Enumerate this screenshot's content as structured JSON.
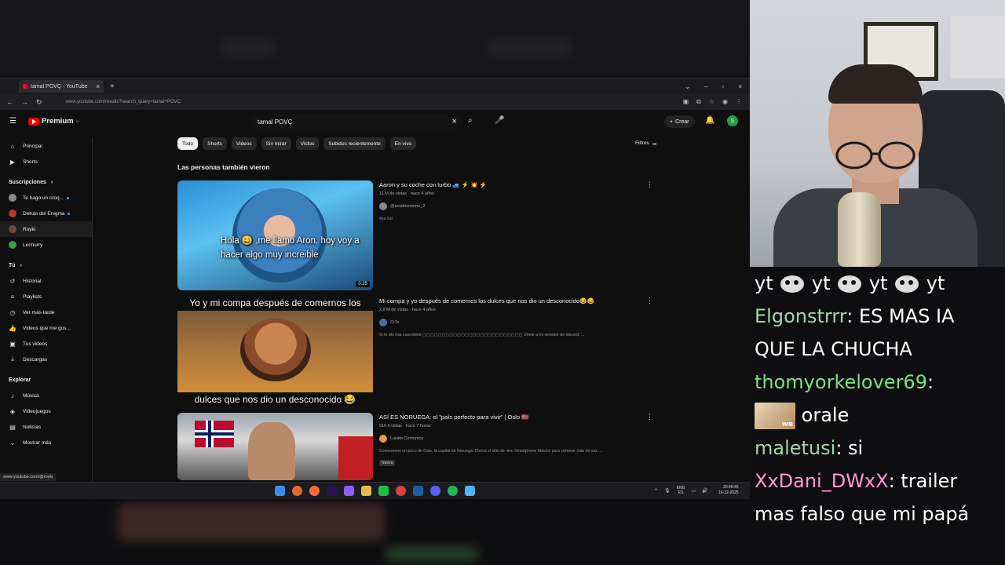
{
  "browser": {
    "tab_title": "tamal POVÇ - YouTube",
    "url": "www.youtube.com/results?search_query=tamal+POVÇ",
    "status_url": "www.youtube.com/@royki"
  },
  "youtube": {
    "logo_text": "Premium",
    "logo_region": "CL",
    "search_value": "tamal POVÇ",
    "create_label": "Crear",
    "avatar_letter": "S",
    "sidebar": {
      "top": [
        {
          "label": "Principal",
          "icon": "home-icon"
        },
        {
          "label": "Shorts",
          "icon": "shorts-icon"
        }
      ],
      "subs_header": "Suscripciones",
      "subs": [
        {
          "label": "Te hago un croq...",
          "color": "#8a8a8a"
        },
        {
          "label": "Detrás del Enigma",
          "color": "#b33b2e"
        },
        {
          "label": "Royki",
          "color": "#6b4a3a"
        },
        {
          "label": "Lechurry",
          "color": "#3aa04a"
        }
      ],
      "you_header": "Tú",
      "you": [
        {
          "label": "Historial",
          "icon": "history-icon"
        },
        {
          "label": "Playlists",
          "icon": "playlists-icon"
        },
        {
          "label": "Ver más tarde",
          "icon": "watch-later-icon"
        },
        {
          "label": "Videos que me gus...",
          "icon": "liked-icon"
        },
        {
          "label": "Tus videos",
          "icon": "your-videos-icon"
        },
        {
          "label": "Descargas",
          "icon": "downloads-icon"
        }
      ],
      "explore_header": "Explorar",
      "explore": [
        {
          "label": "Música",
          "icon": "music-icon"
        },
        {
          "label": "Videojuegos",
          "icon": "gaming-icon"
        },
        {
          "label": "Noticias",
          "icon": "news-icon"
        },
        {
          "label": "Mostrar más",
          "icon": "chevron-down-icon"
        }
      ]
    },
    "chips": [
      "Todo",
      "Shorts",
      "Videos",
      "Sin mirar",
      "Vistos",
      "Subidos recientemente",
      "En vivo"
    ],
    "filters_label": "Filtros",
    "section_title": "Las personas también vieron",
    "results": [
      {
        "title": "Aaron y su coche con turbo 🚙 ⚡ 💥 ⚡",
        "stats": "11 M de vistas · hace 4 años",
        "channel": "@aciaktenonne_2",
        "desc": "#xa #ai",
        "duration": "0:25",
        "caption": "Hola 😄 ,me llamo Aron, hoy voy a hacer algo muy increible"
      },
      {
        "title": "Mi compa y yo después de comernos los dulces que nos dio un desconocido😂😂",
        "stats": "2,8 M de vistas · hace 4 años",
        "channel": "Cr1s",
        "desc": "Si te dio risa suscribete ▢▢▢▢▢▢▢▢▢▢▢▢▢▢▢▢▢▢▢▢▢▢▢▢▢▢ Únete a mi servidor de discord: ...",
        "caption_top": "Yo y mi compa después de comernos los",
        "caption_bottom": "dulces que nos dio un desconocido 😂"
      },
      {
        "title": "ASÍ ES NORUEGA: el \"país perfecto para vivir\" | Oslo 🇳🇴",
        "stats": "516 k vistas · hace 7 horas",
        "channel": "Luisito Comunica",
        "desc": "Conocemos un poco de Oslo, la capital de Noruega. Checa el sitio de vivo Smartphone Mávico para conocer más de sus ...",
        "badge": "Nueva"
      }
    ]
  },
  "taskbar": {
    "lang": "ENG",
    "lang2": "ES",
    "time": "20:46:46",
    "date": "16-12-2025"
  },
  "chat": {
    "messages": [
      {
        "user": "",
        "color": "#ffffff",
        "text": "yt",
        "emotes": true
      },
      {
        "user": "Elgonstrrr",
        "color": "#a5d6a7",
        "text": "ES MAS IA QUE LA CHUCHA"
      },
      {
        "user": "thomyorkelover69",
        "color": "#7ee07e",
        "text": "orale"
      },
      {
        "user": "maletusi",
        "color": "#a5d6a7",
        "text": "si"
      },
      {
        "user": "XxDani_DWxX",
        "color": "#ff9ad5",
        "text": "trailer mas falso que mi papá"
      }
    ],
    "cat_emote_text": "we"
  }
}
